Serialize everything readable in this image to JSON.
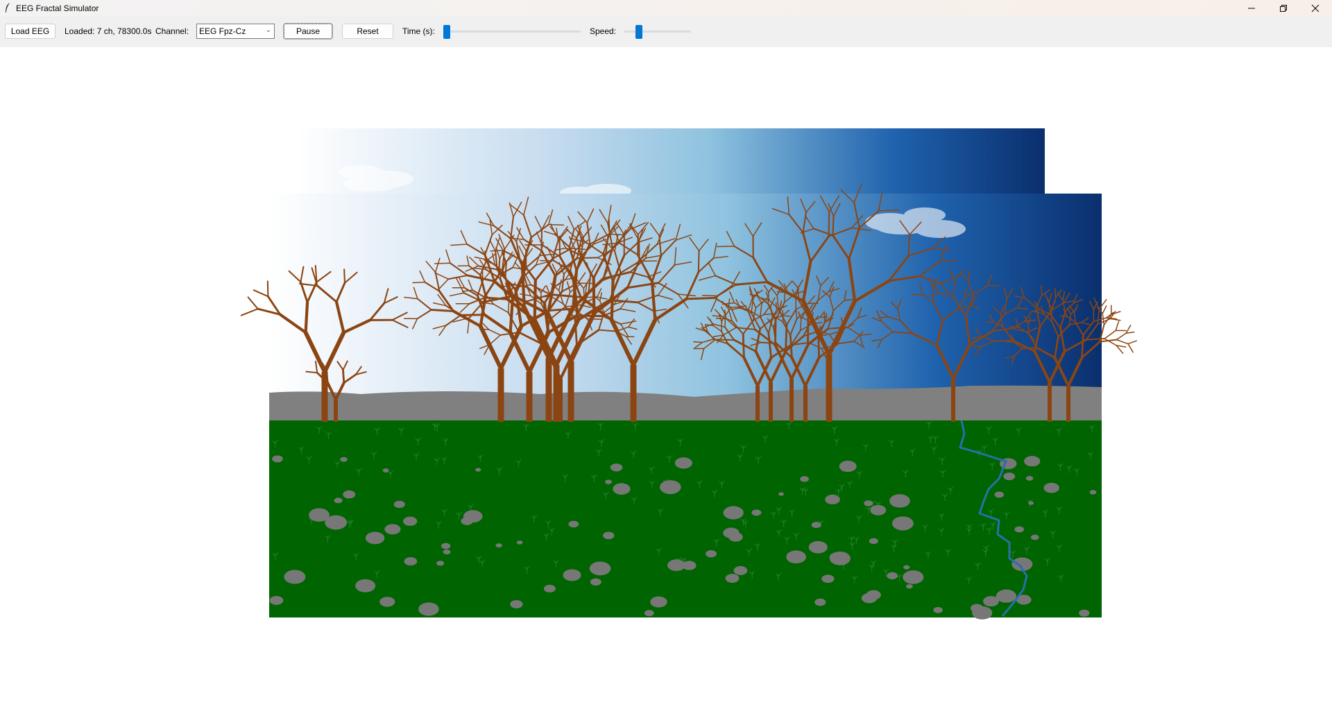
{
  "window": {
    "title": "EEG Fractal Simulator",
    "icon": "feather-icon",
    "controls": [
      "minimize-icon",
      "restore-icon",
      "close-icon"
    ]
  },
  "toolbar": {
    "load_label": "Load EEG",
    "status": "Loaded: 7 ch, 78300.0s",
    "channel_label": "Channel:",
    "channel_value": "EEG Fpz-Cz",
    "pause_label": "Pause",
    "reset_label": "Reset",
    "time_label": "Time (s):",
    "time_fraction": 0.0,
    "speed_label": "Speed:",
    "speed_fraction": 0.2
  },
  "scene": {
    "colors": {
      "sky_top_left": "#ffffff",
      "sky_mid": "#8fc3df",
      "sky_right": "#0a2f6e",
      "hills": "#808080",
      "ground": "#006400",
      "trunk": "#8b4513",
      "rock": "#777777",
      "river": "#2a6fa8",
      "grass": "#2e8b3a"
    }
  }
}
